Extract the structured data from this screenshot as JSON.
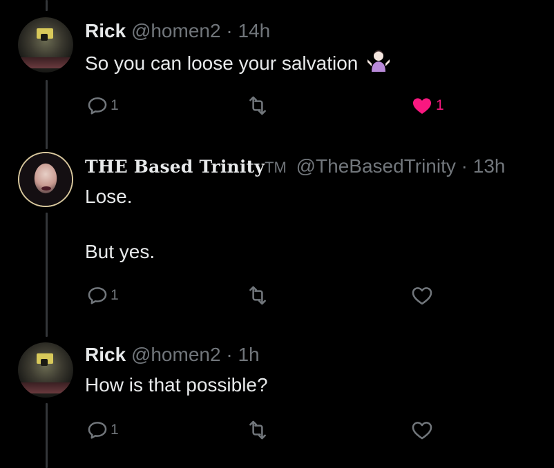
{
  "colors": {
    "background": "#000000",
    "text": "#e7e9ea",
    "muted": "#71767b",
    "like_active": "#f91880",
    "thread_line": "#333639"
  },
  "tweets": [
    {
      "name": "Rick",
      "handle": "@homen2",
      "separator": "·",
      "time": "14h",
      "text_lines": [
        "So you can loose your salvation"
      ],
      "emoji": "woman-shrugging-emoji",
      "actions": {
        "reply": {
          "icon": "reply-icon",
          "count": "1"
        },
        "retweet": {
          "icon": "retweet-icon",
          "count": ""
        },
        "like": {
          "icon": "heart-filled-icon",
          "count": "1",
          "liked": true
        }
      }
    },
    {
      "name": "THE Based Trinity",
      "name_suffix": "TM",
      "handle": "@TheBasedTrinity",
      "separator": "·",
      "time": "13h",
      "text_lines": [
        "Lose.",
        "But yes."
      ],
      "actions": {
        "reply": {
          "icon": "reply-icon",
          "count": "1"
        },
        "retweet": {
          "icon": "retweet-icon",
          "count": ""
        },
        "like": {
          "icon": "heart-icon",
          "count": "",
          "liked": false
        }
      }
    },
    {
      "name": "Rick",
      "handle": "@homen2",
      "separator": "·",
      "time": "1h",
      "text_lines": [
        "How is that possible?"
      ],
      "actions": {
        "reply": {
          "icon": "reply-icon",
          "count": "1"
        },
        "retweet": {
          "icon": "retweet-icon",
          "count": ""
        },
        "like": {
          "icon": "heart-icon",
          "count": "",
          "liked": false
        }
      }
    }
  ]
}
